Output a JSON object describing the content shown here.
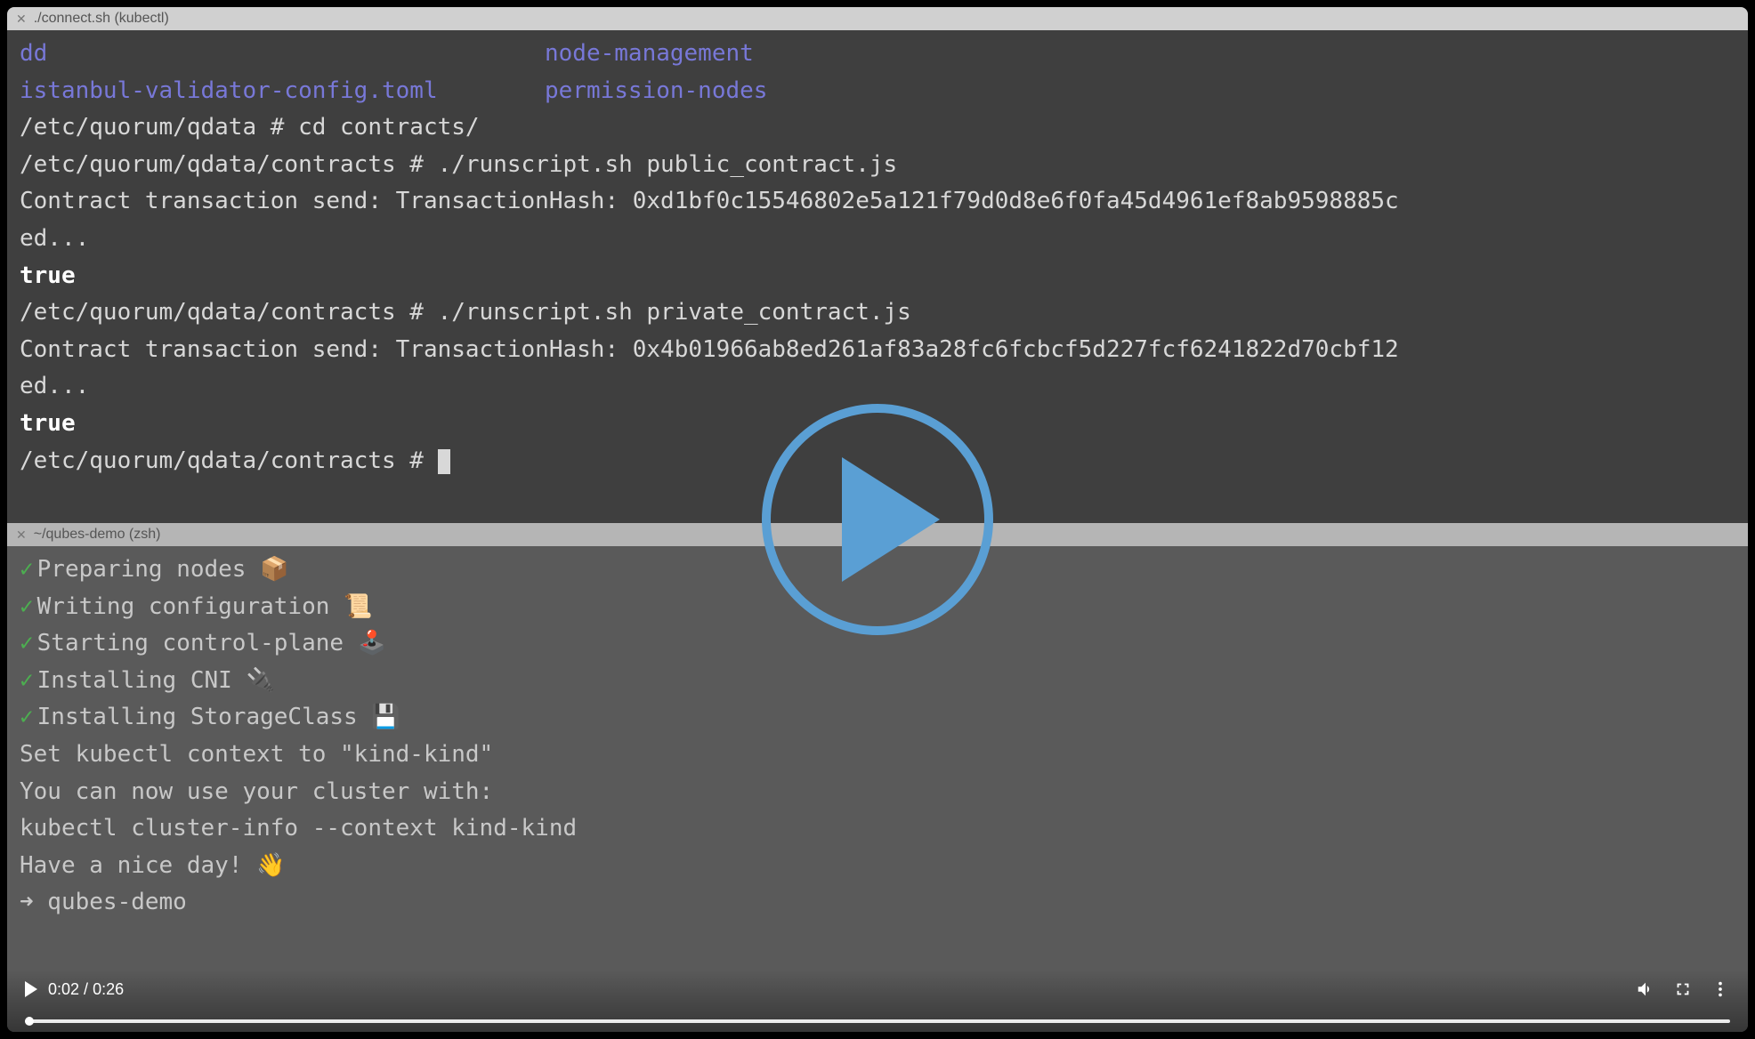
{
  "upper_tab": {
    "title": "./connect.sh (kubectl)"
  },
  "lower_tab": {
    "title": "~/qubes-demo (zsh)"
  },
  "upper_terminal": {
    "ls_row1_col1": "dd",
    "ls_row1_col2": "node-management",
    "ls_row2_col1": "istanbul-validator-config.toml",
    "ls_row2_col2": "permission-nodes",
    "line1": "/etc/quorum/qdata # cd contracts/",
    "line2": "/etc/quorum/qdata/contracts # ./runscript.sh public_contract.js",
    "line3": "Contract transaction send: TransactionHash: 0xd1bf0c15546802e5a121f79d0d8e6f0fa45d4961ef8ab9598885c",
    "line4": "ed...",
    "line5": "true",
    "line6": "/etc/quorum/qdata/contracts # ./runscript.sh private_contract.js",
    "line7": "Contract transaction send: TransactionHash: 0x4b01966ab8ed261af83a28fc6fcbcf5d227fcf6241822d70cbf12",
    "line8": "ed...",
    "line9": "true",
    "line10_prompt": "/etc/quorum/qdata/contracts # "
  },
  "lower_terminal": {
    "step1": "Preparing nodes 📦",
    "step2": "Writing configuration 📜",
    "step3": "Starting control-plane 🕹️",
    "step4": "Installing CNI 🔌",
    "step5": "Installing StorageClass 💾",
    "line6": "Set kubectl context to \"kind-kind\"",
    "line7": "You can now use your cluster with:",
    "line8": "",
    "line9": "kubectl cluster-info --context kind-kind",
    "line10": "",
    "line11": "Have a nice day! 👋",
    "line12_prompt": "➜  qubes-demo"
  },
  "video": {
    "current_time": "0:02",
    "duration": "0:26"
  }
}
